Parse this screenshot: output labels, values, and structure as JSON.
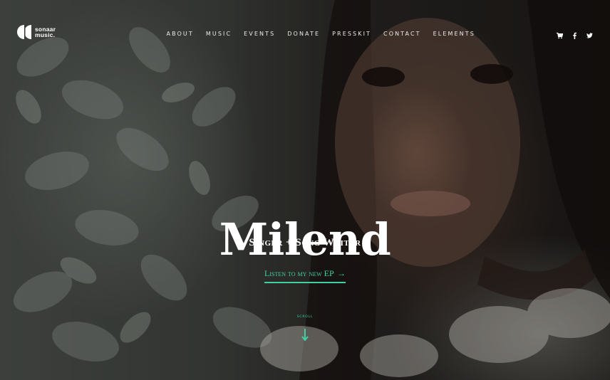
{
  "brand": {
    "name_line1": "sonaar",
    "name_line2": "music."
  },
  "nav": {
    "items": [
      "ABOUT",
      "MUSIC",
      "EVENTS",
      "DONATE",
      "PRESSKIT",
      "CONTACT",
      "ELEMENTS"
    ]
  },
  "social": {
    "icons": [
      "cart-icon",
      "facebook-icon",
      "twitter-icon"
    ]
  },
  "hero": {
    "title": "Milend",
    "subtitle": "Singer + Song Writer",
    "cta_label": "Listen to my new EP",
    "cta_arrow": "→",
    "scroll_label": "SCROLL"
  },
  "colors": {
    "accent": "#3fd0a4",
    "text": "#ffffff"
  }
}
